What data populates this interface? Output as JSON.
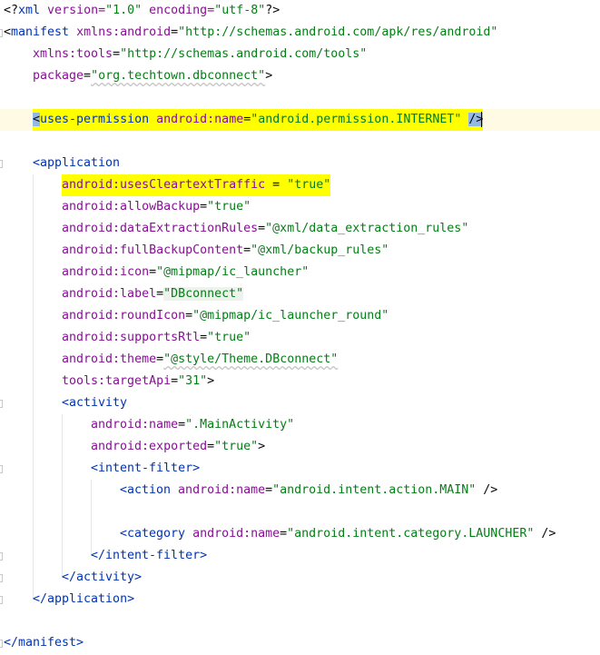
{
  "prolog": {
    "open": "<?",
    "name": "xml",
    "attrs": " version=",
    "version": "\"1.0\"",
    "enc_key": " encoding=",
    "encoding": "\"utf-8\"",
    "close": "?>"
  },
  "manifest": {
    "open": "<",
    "tag": "manifest",
    "xmlns_android_ns": "xmlns",
    "xmlns_android_key": ":android",
    "xmlns_android_val": "\"http://schemas.android.com/apk/res/android\"",
    "xmlns_tools_ns": "xmlns",
    "xmlns_tools_key": ":tools",
    "xmlns_tools_val": "\"http://schemas.android.com/tools\"",
    "package_key": "package",
    "package_val": "\"org.techtown.dbconnect\"",
    "gt": ">",
    "end": "</manifest>"
  },
  "permission": {
    "open": "<",
    "tag": "uses-permission",
    "ns": "android",
    "key": ":name",
    "eq": "=",
    "val": "\"android.permission.INTERNET\"",
    "close": "/>"
  },
  "application": {
    "open": "<application",
    "attrs": [
      {
        "ns": "android",
        "key": ":usesCleartextTraffic",
        "eq": " = ",
        "val": "\"true\""
      },
      {
        "ns": "android",
        "key": ":allowBackup",
        "eq": "=",
        "val": "\"true\""
      },
      {
        "ns": "android",
        "key": ":dataExtractionRules",
        "eq": "=",
        "val": "\"@xml/data_extraction_rules\""
      },
      {
        "ns": "android",
        "key": ":fullBackupContent",
        "eq": "=",
        "val": "\"@xml/backup_rules\""
      },
      {
        "ns": "android",
        "key": ":icon",
        "eq": "=",
        "val": "\"@mipmap/ic_launcher\""
      },
      {
        "ns": "android",
        "key": ":label",
        "eq": "=",
        "val": "\"DBconnect\""
      },
      {
        "ns": "android",
        "key": ":roundIcon",
        "eq": "=",
        "val": "\"@mipmap/ic_launcher_round\""
      },
      {
        "ns": "android",
        "key": ":supportsRtl",
        "eq": "=",
        "val": "\"true\""
      },
      {
        "ns": "android",
        "key": ":theme",
        "eq": "=",
        "val": "\"@style/Theme.DBconnect\""
      },
      {
        "ns": "tools",
        "key": ":targetApi",
        "eq": "=",
        "val": "\"31\"",
        "tail": ">"
      }
    ],
    "end": "</application>"
  },
  "activity": {
    "open": "<activity",
    "name_ns": "android",
    "name_key": ":name",
    "name_val": "\".MainActivity\"",
    "exported_ns": "android",
    "exported_key": ":exported",
    "exported_val": "\"true\"",
    "gt": ">",
    "end": "</activity>"
  },
  "intent_filter": {
    "open": "<intent-filter>",
    "action_open": "<action",
    "action_ns": " android",
    "action_key": ":name",
    "action_val": "\"android.intent.action.MAIN\"",
    "action_close": " />",
    "category_open": "<category",
    "category_ns": " android",
    "category_key": ":name",
    "category_val": "\"android.intent.category.LAUNCHER\"",
    "category_close": " />",
    "end": "</intent-filter>"
  },
  "colors": {
    "tag": "#0033b3",
    "namespace": "#871094",
    "value": "#067d17",
    "highlight": "#ffff00",
    "current_line": "#fffae3"
  }
}
